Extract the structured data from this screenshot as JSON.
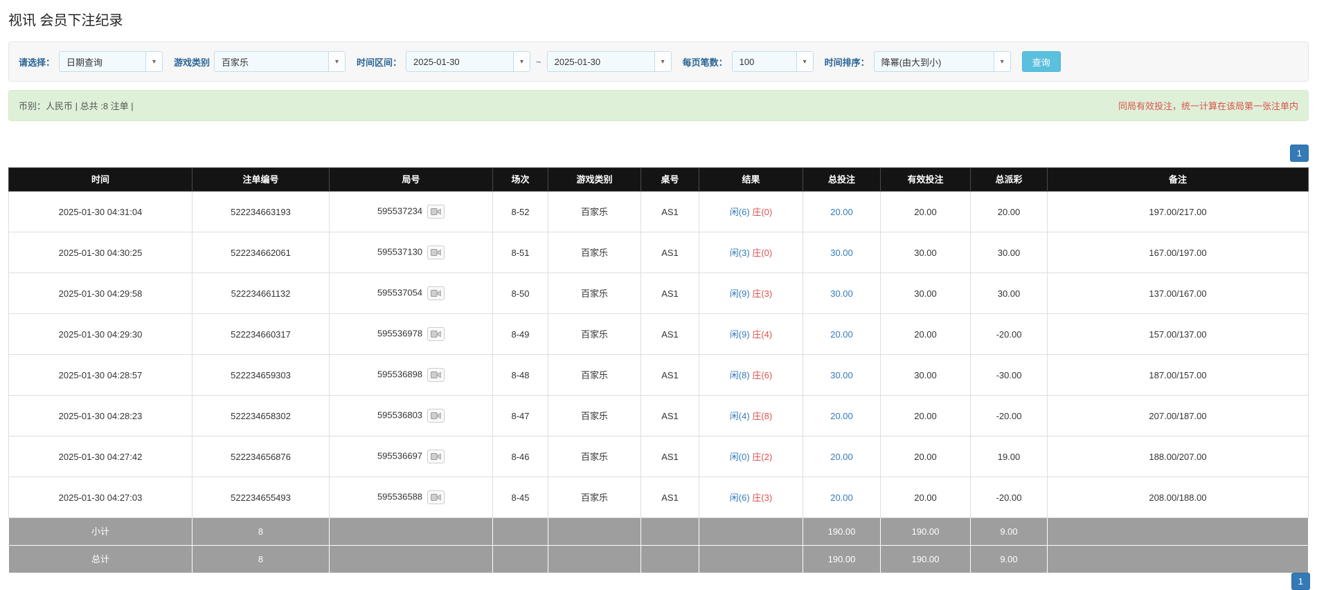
{
  "colors": {
    "accent_blue": "#337ab7",
    "negative_red": "#d9534f",
    "notice_red": "#d9534f",
    "header_bg": "#141414",
    "footer_bg": "#9e9e9e",
    "summary_bg": "#dff0d8",
    "search_button_bg": "#5bc0de"
  },
  "page": {
    "title": "视讯 会员下注纪录"
  },
  "filters": {
    "select_label": "请选择：",
    "select_value": "日期查询",
    "game_type_label": "游戏类别",
    "game_type_value": "百家乐",
    "time_range_label": "时间区间：",
    "date_from": "2025-01-30",
    "range_separator": "~",
    "date_to": "2025-01-30",
    "page_size_label": "每页笔数：",
    "page_size_value": "100",
    "sort_label": "时间排序：",
    "sort_value": "降幂(由大到小)",
    "search_button": "查询"
  },
  "summary": {
    "left_text": "币别：人民币 | 总共 :8 注单 |",
    "right_notice": "同局有效投注，统一计算在该局第一张注单内"
  },
  "pagination": {
    "current_page": "1"
  },
  "icons": {
    "dropdown_caret": "▾",
    "round_replay_icon": "video-camera"
  },
  "table": {
    "headers": [
      "时间",
      "注单编号",
      "局号",
      "场次",
      "游戏类别",
      "桌号",
      "结果",
      "总投注",
      "有效投注",
      "总派彩",
      "备注"
    ],
    "rows": [
      {
        "time": "2025-01-30 04:31:04",
        "bet_id": "522234663193",
        "round_id": "595537234",
        "session": "8-52",
        "game": "百家乐",
        "table_no": "AS1",
        "result_player": "闲(6)",
        "result_banker": "庄(0)",
        "total_bet": "20.00",
        "valid_bet": "20.00",
        "payout": "20.00",
        "remark": "197.00/217.00"
      },
      {
        "time": "2025-01-30 04:30:25",
        "bet_id": "522234662061",
        "round_id": "595537130",
        "session": "8-51",
        "game": "百家乐",
        "table_no": "AS1",
        "result_player": "闲(3)",
        "result_banker": "庄(0)",
        "total_bet": "30.00",
        "valid_bet": "30.00",
        "payout": "30.00",
        "remark": "167.00/197.00"
      },
      {
        "time": "2025-01-30 04:29:58",
        "bet_id": "522234661132",
        "round_id": "595537054",
        "session": "8-50",
        "game": "百家乐",
        "table_no": "AS1",
        "result_player": "闲(9)",
        "result_banker": "庄(3)",
        "total_bet": "30.00",
        "valid_bet": "30.00",
        "payout": "30.00",
        "remark": "137.00/167.00"
      },
      {
        "time": "2025-01-30 04:29:30",
        "bet_id": "522234660317",
        "round_id": "595536978",
        "session": "8-49",
        "game": "百家乐",
        "table_no": "AS1",
        "result_player": "闲(9)",
        "result_banker": "庄(4)",
        "total_bet": "20.00",
        "valid_bet": "20.00",
        "payout": "-20.00",
        "remark": "157.00/137.00"
      },
      {
        "time": "2025-01-30 04:28:57",
        "bet_id": "522234659303",
        "round_id": "595536898",
        "session": "8-48",
        "game": "百家乐",
        "table_no": "AS1",
        "result_player": "闲(8)",
        "result_banker": "庄(6)",
        "total_bet": "30.00",
        "valid_bet": "30.00",
        "payout": "-30.00",
        "remark": "187.00/157.00"
      },
      {
        "time": "2025-01-30 04:28:23",
        "bet_id": "522234658302",
        "round_id": "595536803",
        "session": "8-47",
        "game": "百家乐",
        "table_no": "AS1",
        "result_player": "闲(4)",
        "result_banker": "庄(8)",
        "total_bet": "20.00",
        "valid_bet": "20.00",
        "payout": "-20.00",
        "remark": "207.00/187.00"
      },
      {
        "time": "2025-01-30 04:27:42",
        "bet_id": "522234656876",
        "round_id": "595536697",
        "session": "8-46",
        "game": "百家乐",
        "table_no": "AS1",
        "result_player": "闲(0)",
        "result_banker": "庄(2)",
        "total_bet": "20.00",
        "valid_bet": "20.00",
        "payout": "19.00",
        "remark": "188.00/207.00"
      },
      {
        "time": "2025-01-30 04:27:03",
        "bet_id": "522234655493",
        "round_id": "595536588",
        "session": "8-45",
        "game": "百家乐",
        "table_no": "AS1",
        "result_player": "闲(6)",
        "result_banker": "庄(3)",
        "total_bet": "20.00",
        "valid_bet": "20.00",
        "payout": "-20.00",
        "remark": "208.00/188.00"
      }
    ],
    "subtotal": {
      "label": "小计",
      "count": "8",
      "total_bet": "190.00",
      "valid_bet": "190.00",
      "payout": "9.00"
    },
    "grand_total": {
      "label": "总计",
      "count": "8",
      "total_bet": "190.00",
      "valid_bet": "190.00",
      "payout": "9.00"
    }
  }
}
